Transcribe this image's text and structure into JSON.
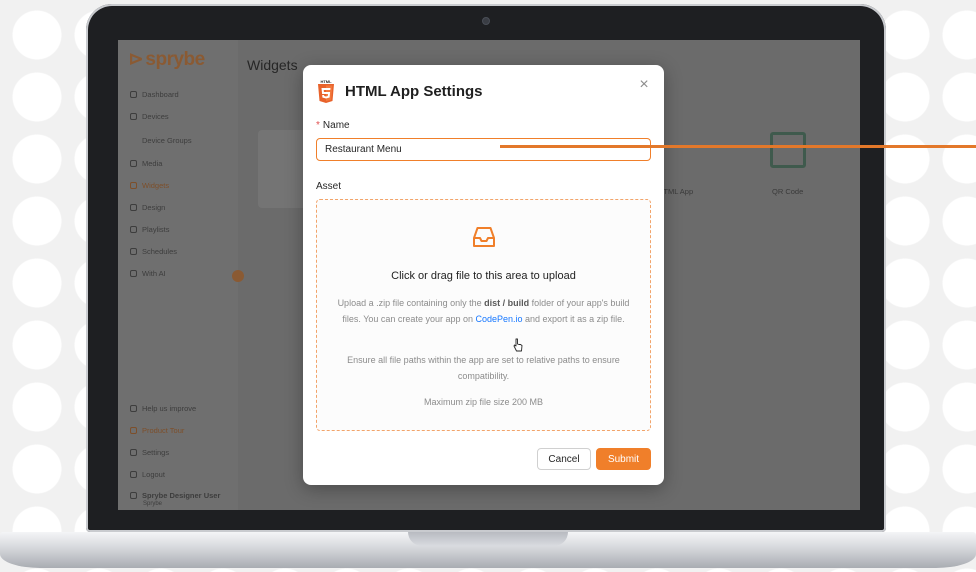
{
  "app": {
    "logo_text": "sprybe",
    "page_title": "Widgets"
  },
  "sidebar": {
    "items": [
      {
        "label": "Dashboard"
      },
      {
        "label": "Devices"
      },
      {
        "label": "Device Groups"
      },
      {
        "label": "Media"
      },
      {
        "label": "Widgets"
      },
      {
        "label": "Design"
      },
      {
        "label": "Playlists"
      },
      {
        "label": "Schedules"
      },
      {
        "label": "With AI"
      }
    ],
    "footer_items": [
      {
        "label": "Help us improve"
      },
      {
        "label": "Product Tour"
      },
      {
        "label": "Settings"
      },
      {
        "label": "Logout"
      }
    ],
    "user_name": "Sprybe Designer User",
    "user_role": "Sprybe"
  },
  "background_widgets": {
    "html_label": "HTML App",
    "qr_label": "QR Code"
  },
  "modal": {
    "html5_badge": "HTML",
    "title": "HTML App Settings",
    "close": "×",
    "name_label": "Name",
    "required_mark": "*",
    "name_value": "Restaurant Menu",
    "asset_label": "Asset",
    "dropzone": {
      "title": "Click or drag file to this area to upload",
      "desc_part1": "Upload a .zip file containing only the ",
      "desc_bold": "dist / build",
      "desc_part2": " folder of your app's build files. You can create your app on ",
      "desc_link": "CodePen.io",
      "desc_part3": " and export it as a zip file.",
      "paths_note": "Ensure all file paths within the app are set to relative paths to ensure compatibility.",
      "max_size": "Maximum zip file size 200 MB"
    },
    "cancel_label": "Cancel",
    "submit_label": "Submit"
  },
  "colors": {
    "accent": "#f07f2a",
    "link": "#1677ff"
  }
}
